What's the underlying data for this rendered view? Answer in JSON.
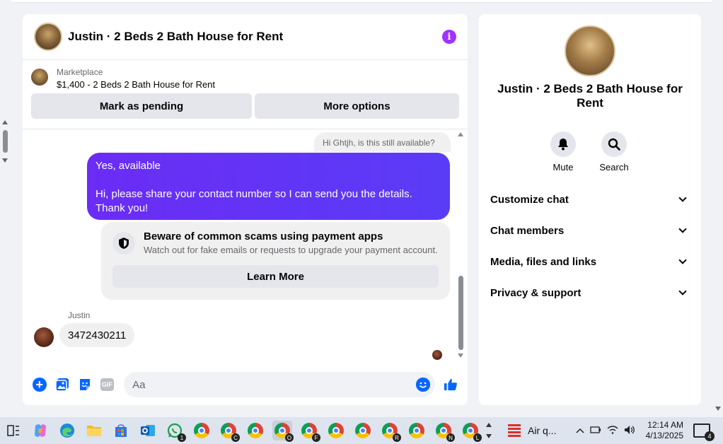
{
  "chat": {
    "title": "Justin · 2 Beds 2 Bath House for Rent",
    "listing": {
      "source": "Marketplace",
      "price_title": "$1,400 - 2 Beds 2 Bath House for Rent",
      "pending_label": "Mark as pending",
      "more_label": "More options"
    },
    "messages": {
      "incoming_top": "Hi Ghtjh, is this still available?",
      "outgoing_line1": "Yes, available",
      "outgoing_line2": "Hi, please share your contact number so I can send you the details. Thank you!",
      "scam_title": "Beware of common scams using payment apps",
      "scam_desc": "Watch out for fake emails or requests to upgrade your payment account.",
      "learn_more": "Learn More",
      "sender": "Justin",
      "incoming_reply": "3472430211"
    },
    "composer": {
      "placeholder": "Aa",
      "gif_label": "GIF"
    }
  },
  "details": {
    "title": "Justin · 2 Beds 2 Bath House for Rent",
    "actions": {
      "mute": "Mute",
      "search": "Search"
    },
    "sections": [
      "Customize chat",
      "Chat members",
      "Media, files and links",
      "Privacy & support"
    ]
  },
  "taskbar": {
    "weather": "Air q...",
    "time": "12:14 AM",
    "date": "4/13/2025",
    "whatsapp_badge": "1",
    "notifications_count": "4",
    "chrome_badges": [
      "",
      "C",
      "",
      "O",
      "F",
      "",
      "",
      "R",
      "",
      "N",
      "L"
    ]
  },
  "colors": {
    "accent_blue": "#0866ff",
    "bubble_purple": "#5a3cf6",
    "info_purple": "#a033ff"
  }
}
